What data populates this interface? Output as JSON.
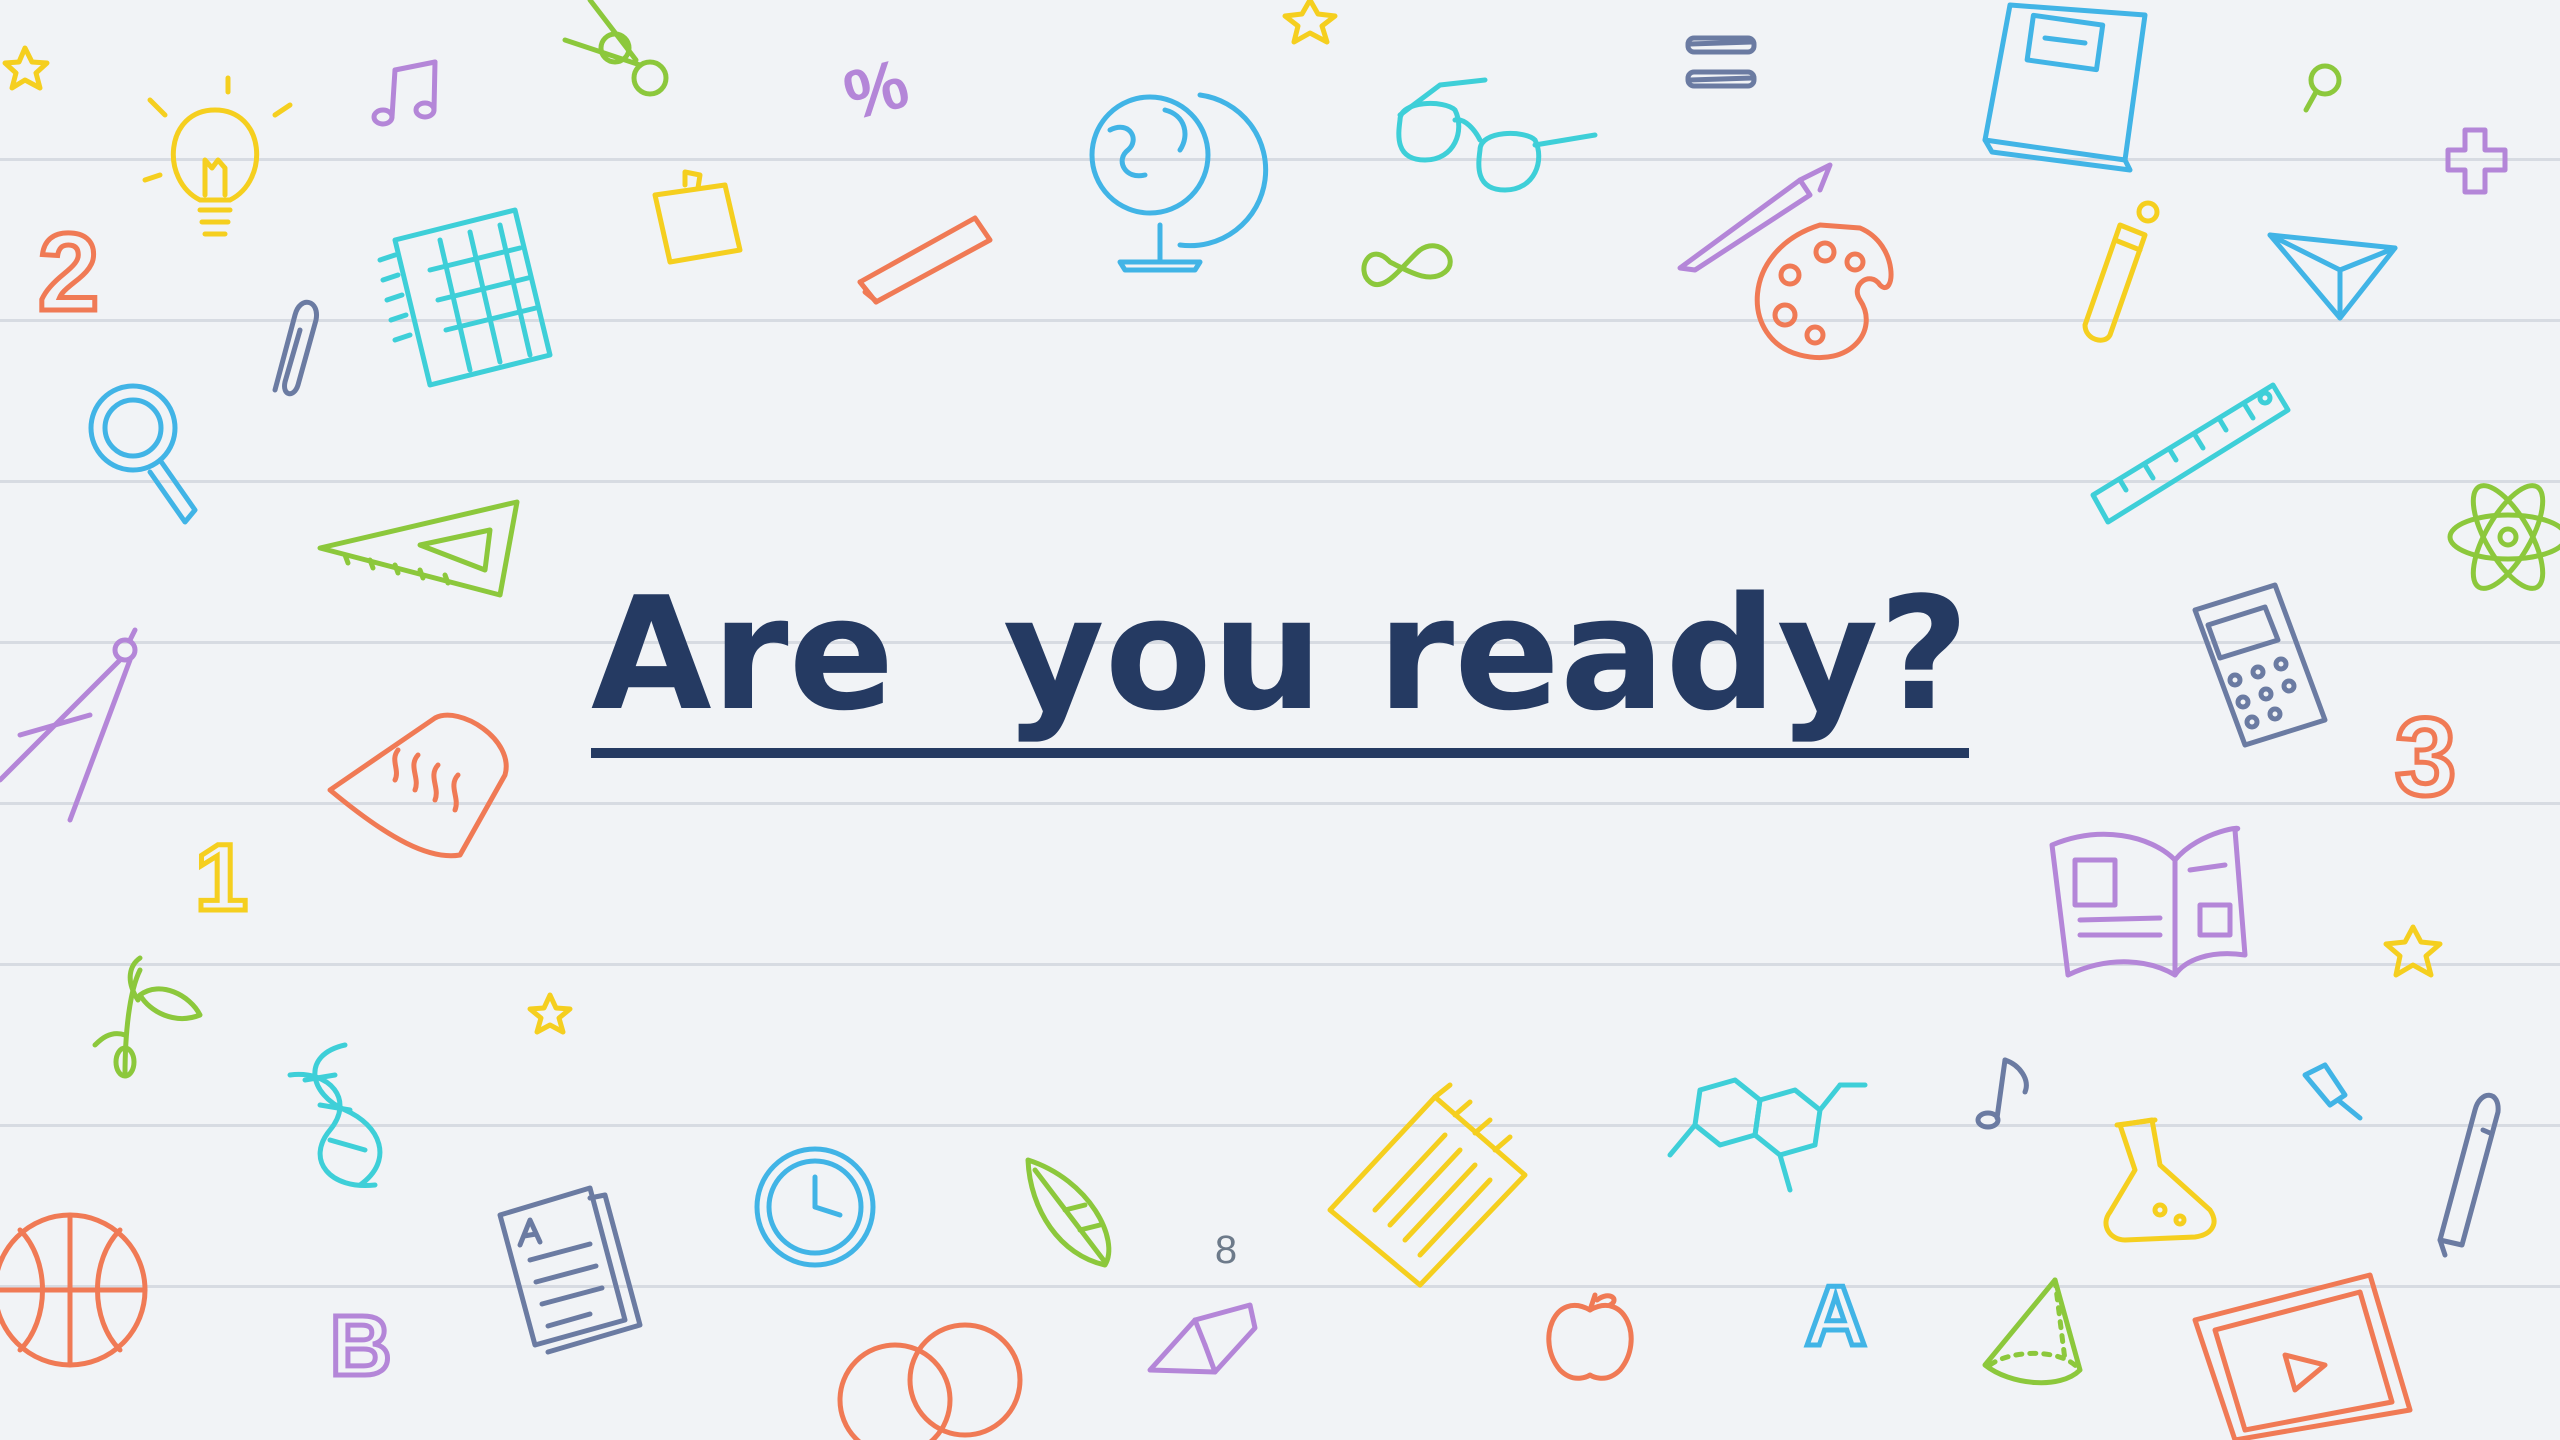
{
  "slide": {
    "title": "Are  you ready?",
    "page_number": "8"
  },
  "colors": {
    "background": "#f1f3f6",
    "title_text": "#253a62",
    "doodle_blue": "#41b4e6",
    "doodle_purple": "#b486d8",
    "doodle_orange": "#f07a55",
    "doodle_green": "#8cc83c",
    "doodle_yellow": "#f5cf1f",
    "doodle_cyan": "#3ecfd8",
    "doodle_slate": "#6b7ba2"
  },
  "doodles": {
    "digit_2": "2",
    "digit_1": "1",
    "digit_3": "3",
    "letter_b": "B",
    "letter_a": "A",
    "percent": "%",
    "equals": "="
  }
}
